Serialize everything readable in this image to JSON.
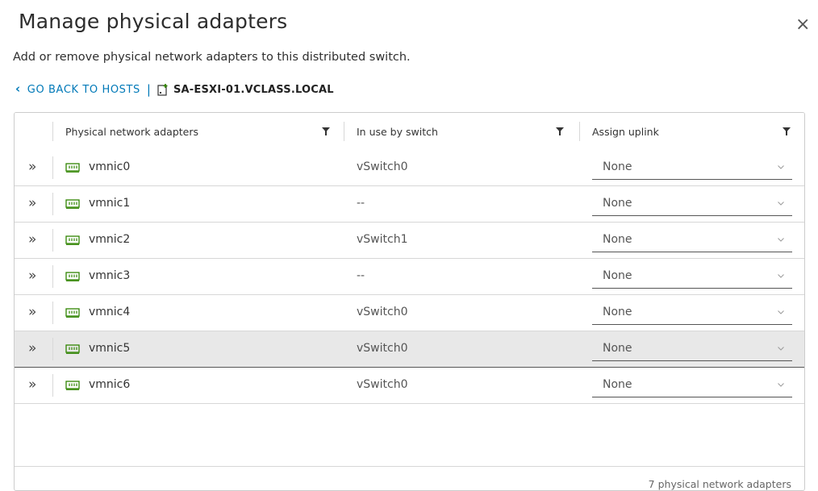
{
  "dialog": {
    "title": "Manage physical adapters",
    "subtitle": "Add or remove physical network adapters to this distributed switch.",
    "close_icon": "×"
  },
  "breadcrumb": {
    "back_label": "GO BACK TO HOSTS",
    "back_icon": "chevron-left",
    "separator": "|",
    "host_icon": "host-icon",
    "host": "SA-ESXI-01.VCLASS.LOCAL"
  },
  "table": {
    "columns": [
      "Physical network adapters",
      "In use by switch",
      "Assign uplink"
    ],
    "rows": [
      {
        "expander": "»",
        "adapter": "vmnic0",
        "switch": "vSwitch0",
        "uplink": "None"
      },
      {
        "expander": "»",
        "adapter": "vmnic1",
        "switch": "--",
        "uplink": "None"
      },
      {
        "expander": "»",
        "adapter": "vmnic2",
        "switch": "vSwitch1",
        "uplink": "None"
      },
      {
        "expander": "»",
        "adapter": "vmnic3",
        "switch": "--",
        "uplink": "None"
      },
      {
        "expander": "»",
        "adapter": "vmnic4",
        "switch": "vSwitch0",
        "uplink": "None"
      },
      {
        "expander": "»",
        "adapter": "vmnic5",
        "switch": "vSwitch0",
        "uplink": "None",
        "selected": true
      },
      {
        "expander": "»",
        "adapter": "vmnic6",
        "switch": "vSwitch0",
        "uplink": "None"
      }
    ],
    "footer": "7 physical network adapters"
  },
  "colors": {
    "link": "#0079b8",
    "nic_icon": "#2f8400",
    "selected_row": "#e8e8e8"
  }
}
